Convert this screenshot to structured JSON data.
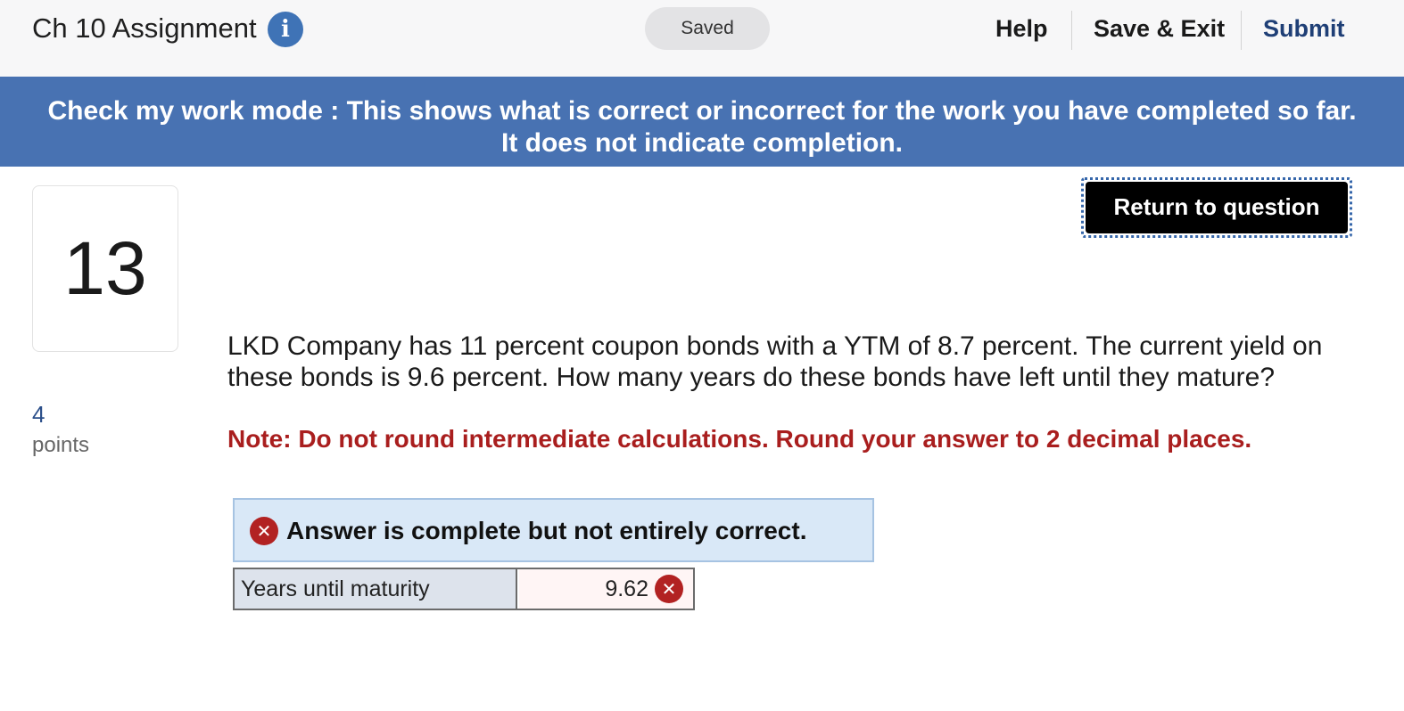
{
  "header": {
    "title": "Ch 10 Assignment",
    "info_icon": "info-icon",
    "saved_label": "Saved",
    "help_label": "Help",
    "save_exit_label": "Save & Exit",
    "submit_label": "Submit"
  },
  "banner": {
    "line1": "Check my work mode : This shows what is correct or incorrect for the work you have completed so far.",
    "line2": "It does not indicate completion."
  },
  "question": {
    "number": "13",
    "points_value": "4",
    "points_label": "points",
    "return_label": "Return to question",
    "text": "LKD Company has 11 percent coupon bonds with a YTM of 8.7 percent. The current yield on these bonds is 9.6 percent. How many years do these bonds have left until they mature?",
    "note": "Note: Do not round intermediate calculations. Round your answer to 2 decimal places."
  },
  "feedback": {
    "icon": "error-x-icon",
    "message": "Answer is complete but not entirely correct."
  },
  "answer_table": {
    "rows": [
      {
        "label": "Years until maturity",
        "value": "9.62",
        "status_icon": "incorrect-x-icon"
      }
    ]
  },
  "colors": {
    "banner_bg": "#4872b2",
    "note_red": "#a91e1e",
    "submit_blue": "#1f3f76",
    "feedback_bg": "#d9e8f7",
    "error_red": "#b22222"
  }
}
